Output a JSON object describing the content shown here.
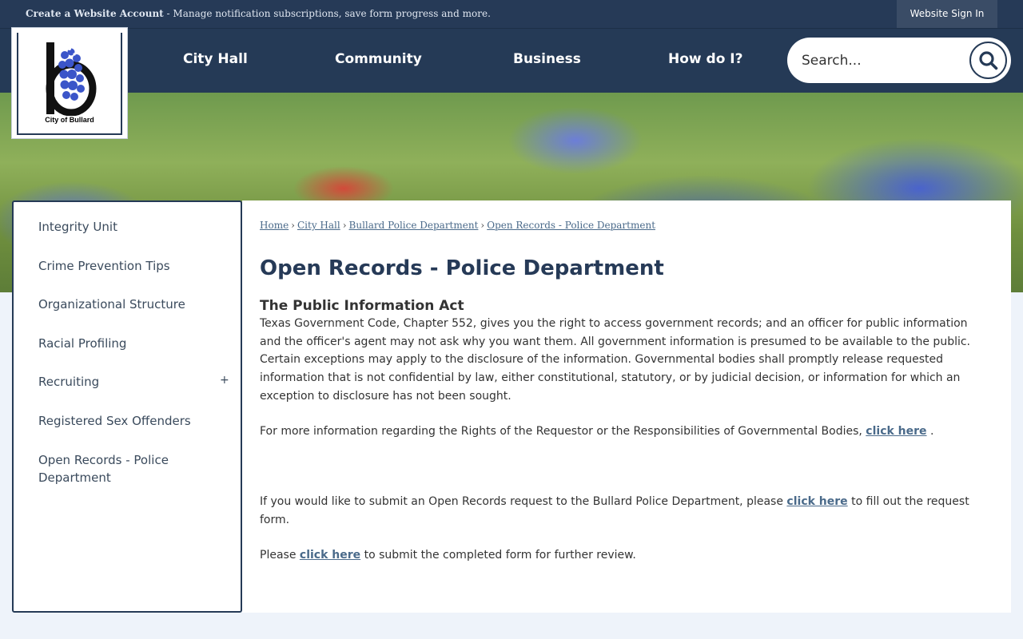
{
  "topbar": {
    "create_account_link": "Create a Website Account",
    "create_account_text": " - Manage notification subscriptions, save form progress and more.",
    "sign_in": "Website Sign In"
  },
  "logo": {
    "label": "City of Bullard",
    "letter": "b",
    "icon": "bluebonnet-b-logo"
  },
  "nav": {
    "items": [
      "City Hall",
      "Community",
      "Business",
      "How do I?"
    ]
  },
  "search": {
    "placeholder": "Search...",
    "icon": "search-icon"
  },
  "sidebar": {
    "items": [
      {
        "label": "Integrity Unit"
      },
      {
        "label": "Crime Prevention Tips"
      },
      {
        "label": "Organizational Structure"
      },
      {
        "label": "Racial Profiling"
      },
      {
        "label": "Recruiting",
        "expand": "+"
      },
      {
        "label": "Registered Sex Offenders"
      },
      {
        "label": "Open Records - Police Department"
      }
    ]
  },
  "breadcrumb": [
    "Home",
    "City Hall",
    "Bullard Police Department",
    "Open Records - Police Department"
  ],
  "breadcrumb_sep": "›",
  "main": {
    "title": "Open Records - Police Department",
    "subheading": "The Public Information Act",
    "p1": "Texas Government Code, Chapter 552, gives you the right to access government records; and an officer for public information and the officer's agent may not ask why you want them. All government information is presumed to be available to the public. Certain exceptions may apply to the disclosure of the information. Governmental bodies shall promptly release requested information that is not confidential by law, either constitutional, statutory, or by judicial decision, or information for which an exception to disclosure has not been sought.",
    "p2_before": "For more information regarding the Rights of the Requestor or the Responsibilities of Governmental Bodies, ",
    "p2_link": "click here",
    "p2_after": " .",
    "p3_before": "If you would like to submit an Open Records request to the Bullard Police Department, please ",
    "p3_link": "click here",
    "p3_after": " to fill out the request form.",
    "p4_before": "Please ",
    "p4_link": "click here",
    "p4_after": " to submit the completed form for further review."
  },
  "colors": {
    "navy": "#253a56",
    "link": "#4a6a8a",
    "background": "#eef3fa"
  }
}
